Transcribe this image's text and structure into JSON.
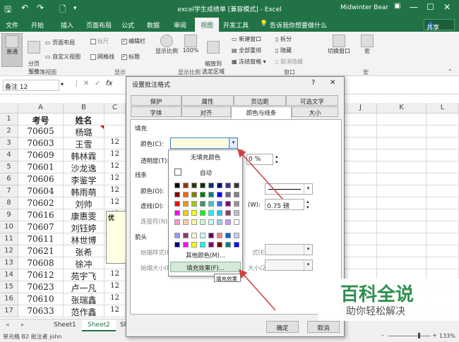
{
  "titlebar": {
    "title": "excel学生成绩单 [兼容模式] - Excel",
    "user": "Midwinter Bear",
    "save_icon": "save-icon",
    "undo_icon": "undo-icon",
    "redo_icon": "redo-icon",
    "new_icon": "new-file-icon",
    "customize_icon": "customize-icon",
    "ribbon_display_icon": "ribbon-display-icon",
    "minimize": "—",
    "restore": "☐",
    "close": "✕"
  },
  "tabs": [
    "文件",
    "开始",
    "插入",
    "页面布局",
    "公式",
    "数据",
    "审阅",
    "视图",
    "开发工具"
  ],
  "active_tab": "视图",
  "tell_me": "告诉我你想要做什么",
  "share": "共享",
  "ribbon": {
    "normal": "普通",
    "page_break": "分页\n预览",
    "page_layout": "页面布局",
    "custom_views": "自定义视图",
    "ruler": "标尺",
    "gridlines": "网格线",
    "formula_bar": "编辑栏",
    "headings": "标题",
    "zoom": "显示比例",
    "zoom100": "100%",
    "zoom_selection": "缩放到\n选定区域",
    "new_window": "新建窗口",
    "arrange_all": "全部重排",
    "freeze": "冻结窗格",
    "split": "拆分",
    "hide": "隐藏",
    "unhide": "取消隐藏",
    "switch_windows": "切换窗口",
    "macros": "宏",
    "group_workbook_views": "工作簿视图",
    "group_show": "显示",
    "group_zoom": "显示比例",
    "group_window": "窗口",
    "group_macros": "宏"
  },
  "namebox": "备注 12",
  "columns": [
    "A",
    "B",
    "C",
    "J",
    "K",
    "L"
  ],
  "rows": [
    {
      "n": "1",
      "a": "考号",
      "b": "姓名"
    },
    {
      "n": "2",
      "a": "70605",
      "b": "杨璐"
    },
    {
      "n": "3",
      "a": "70603",
      "b": "王雪"
    },
    {
      "n": "4",
      "a": "70609",
      "b": "韩林霖"
    },
    {
      "n": "5",
      "a": "70601",
      "b": "沙龙逸"
    },
    {
      "n": "6",
      "a": "70606",
      "b": "李鉴学"
    },
    {
      "n": "7",
      "a": "70604",
      "b": "韩雨萌"
    },
    {
      "n": "8",
      "a": "70602",
      "b": "刘帅"
    },
    {
      "n": "9",
      "a": "70616",
      "b": "康惠雯"
    },
    {
      "n": "10",
      "a": "70607",
      "b": "刘钰婷"
    },
    {
      "n": "11",
      "a": "70611",
      "b": "林世博"
    },
    {
      "n": "12",
      "a": "70621",
      "b": "张希"
    },
    {
      "n": "13",
      "a": "70608",
      "b": "徐冲"
    },
    {
      "n": "14",
      "a": "70612",
      "b": "苑宇飞"
    },
    {
      "n": "15",
      "a": "70623",
      "b": "卢一凡"
    },
    {
      "n": "16",
      "a": "70610",
      "b": "张瑞鑫"
    },
    {
      "n": "17",
      "a": "70633",
      "b": "范作鑫"
    }
  ],
  "col_c_partial": "12",
  "comment_text": "优",
  "sheets": [
    "Sheet1",
    "Sheet2",
    "Sh"
  ],
  "active_sheet": "Sheet2",
  "status": {
    "left": "单元格 B2 批注者 john",
    "zoom": "133%"
  },
  "dialog": {
    "title": "设置批注格式",
    "help": "?",
    "close": "✕",
    "tabs_row1": [
      "保护",
      "属性",
      "页边距",
      "可选文字"
    ],
    "tabs_row2": [
      "字体",
      "对齐",
      "颜色与线条",
      "大小"
    ],
    "active_tab": "颜色与线条",
    "fill_section": "填充",
    "color_label": "颜色(C):",
    "transparency_label": "透明度(T):",
    "transparency_value": "0 %",
    "line_section": "线条",
    "line_color_label": "颜色(O):",
    "dash_label": "虚线(D):",
    "connector_label": "连接符(N):",
    "weight_label": "(W):",
    "weight_value": "0.75 磅",
    "arrows_section": "箭头",
    "begin_style_label": "始端样式(B)",
    "begin_size_label": "始端大小(I):",
    "end_style_label": "式(E):",
    "end_size_label": "大小(Z):",
    "ok": "确定",
    "cancel": "取消",
    "fill_color": "#fdfbd8"
  },
  "color_popup": {
    "no_fill": "无填充颜色",
    "automatic": "自动",
    "more_colors": "其他颜色(M)...",
    "fill_effects": "填充效果(F)...",
    "palette": [
      [
        "#000000",
        "#993300",
        "#333300",
        "#003300",
        "#003366",
        "#000080",
        "#333399",
        "#333333"
      ],
      [
        "#800000",
        "#ff6600",
        "#808000",
        "#008000",
        "#008080",
        "#0000ff",
        "#666699",
        "#808080"
      ],
      [
        "#ff0000",
        "#ff9900",
        "#99cc00",
        "#339966",
        "#33cccc",
        "#3366ff",
        "#800080",
        "#969696"
      ],
      [
        "#ff00ff",
        "#ffcc00",
        "#ffff00",
        "#00ff00",
        "#00ffff",
        "#00ccff",
        "#993366",
        "#c0c0c0"
      ],
      [
        "#ff99cc",
        "#ffcc99",
        "#ffff99",
        "#ccffcc",
        "#ccffff",
        "#99ccff",
        "#cc99ff",
        "#ffffff"
      ],
      [
        "#9999ff",
        "#993366",
        "#ffffcc",
        "#ccffff",
        "#660066",
        "#ff8080",
        "#0066cc",
        "#ccccff"
      ],
      [
        "#000080",
        "#ff00ff",
        "#ffff00",
        "#00ffff",
        "#800080",
        "#800000",
        "#008080",
        "#0000ff"
      ]
    ]
  },
  "tooltip": "填充效果",
  "watermark": {
    "title": "百科全说",
    "subtitle": "助你轻松解决"
  }
}
